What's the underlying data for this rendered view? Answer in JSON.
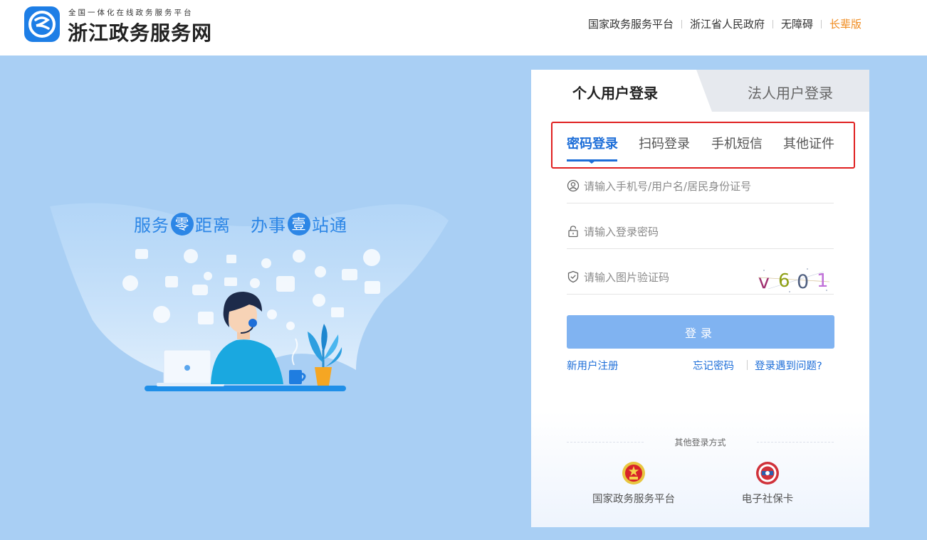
{
  "header": {
    "subtitle": "全国一体化在线政务服务平台",
    "title": "浙江政务服务网",
    "links": [
      {
        "label": "国家政务服务平台"
      },
      {
        "label": "浙江省人民政府"
      },
      {
        "label": "无障碍"
      },
      {
        "label": "长辈版"
      }
    ]
  },
  "hero": {
    "slogan_a": "服务",
    "slogan_a_circle": "零",
    "slogan_b": "距离",
    "slogan_c": "办事",
    "slogan_c_circle": "壹",
    "slogan_d": "站通"
  },
  "login": {
    "tabs": {
      "personal": "个人用户登录",
      "legal": "法人用户登录"
    },
    "subtabs": [
      {
        "label": "密码登录"
      },
      {
        "label": "扫码登录"
      },
      {
        "label": "手机短信"
      },
      {
        "label": "其他证件"
      }
    ],
    "username_placeholder": "请输入手机号/用户名/居民身份证号",
    "password_placeholder": "请输入登录密码",
    "captcha_placeholder": "请输入图片验证码",
    "captcha_chars": [
      "v",
      "6",
      "0",
      "1"
    ],
    "submit_label": "登录",
    "register_label": "新用户注册",
    "forgot_label": "忘记密码",
    "problem_label": "登录遇到问题?",
    "other_title": "其他登录方式",
    "alt_methods": [
      {
        "label": "国家政务服务平台",
        "icon": "national-emblem-icon"
      },
      {
        "label": "电子社保卡",
        "icon": "social-security-card-icon"
      }
    ]
  },
  "colors": {
    "background": "#a9cff4",
    "primary": "#1d6ed8",
    "button": "#80b3f1",
    "elder_link": "#f08b1e",
    "highlight_box": "#e02020"
  }
}
